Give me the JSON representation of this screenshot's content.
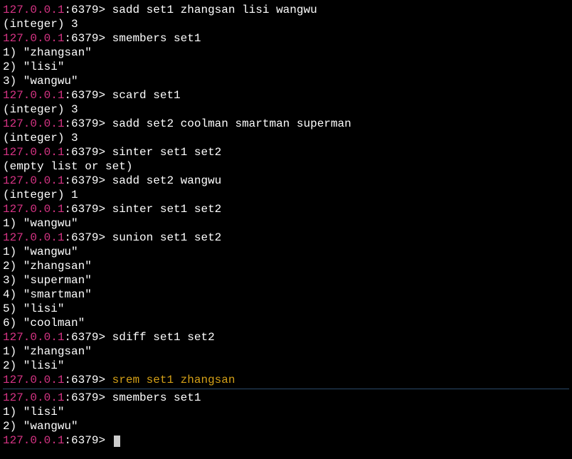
{
  "prompt": {
    "host": "127.0.0.1",
    "port": ":6379",
    "arrow": "> "
  },
  "lines": [
    {
      "type": "cmd",
      "host": "127.0.0.1",
      "port": ":6379",
      "arrow": "> ",
      "text": "sadd set1 zhangsan lisi wangwu"
    },
    {
      "type": "out",
      "text": "(integer) 3"
    },
    {
      "type": "cmd",
      "host": "127.0.0.1",
      "port": ":6379",
      "arrow": "> ",
      "text": "smembers set1"
    },
    {
      "type": "out",
      "text": "1) \"zhangsan\""
    },
    {
      "type": "out",
      "text": "2) \"lisi\""
    },
    {
      "type": "out",
      "text": "3) \"wangwu\""
    },
    {
      "type": "cmd",
      "host": "127.0.0.1",
      "port": ":6379",
      "arrow": "> ",
      "text": "scard set1"
    },
    {
      "type": "out",
      "text": "(integer) 3"
    },
    {
      "type": "cmd",
      "host": "127.0.0.1",
      "port": ":6379",
      "arrow": "> ",
      "text": "sadd set2 coolman smartman superman"
    },
    {
      "type": "out",
      "text": "(integer) 3"
    },
    {
      "type": "cmd",
      "host": "127.0.0.1",
      "port": ":6379",
      "arrow": "> ",
      "text": "sinter set1 set2"
    },
    {
      "type": "out",
      "text": "(empty list or set)"
    },
    {
      "type": "cmd",
      "host": "127.0.0.1",
      "port": ":6379",
      "arrow": "> ",
      "text": "sadd set2 wangwu"
    },
    {
      "type": "out",
      "text": "(integer) 1"
    },
    {
      "type": "cmd",
      "host": "127.0.0.1",
      "port": ":6379",
      "arrow": "> ",
      "text": "sinter set1 set2"
    },
    {
      "type": "out",
      "text": "1) \"wangwu\""
    },
    {
      "type": "cmd",
      "host": "127.0.0.1",
      "port": ":6379",
      "arrow": "> ",
      "text": "sunion set1 set2"
    },
    {
      "type": "out",
      "text": "1) \"wangwu\""
    },
    {
      "type": "out",
      "text": "2) \"zhangsan\""
    },
    {
      "type": "out",
      "text": "3) \"superman\""
    },
    {
      "type": "out",
      "text": "4) \"smartman\""
    },
    {
      "type": "out",
      "text": "5) \"lisi\""
    },
    {
      "type": "out",
      "text": "6) \"coolman\""
    },
    {
      "type": "cmd",
      "host": "127.0.0.1",
      "port": ":6379",
      "arrow": "> ",
      "text": "sdiff set1 set2"
    },
    {
      "type": "out",
      "text": "1) \"zhangsan\""
    },
    {
      "type": "out",
      "text": "2) \"lisi\""
    },
    {
      "type": "cmd-yellow",
      "host": "127.0.0.1",
      "port": ":6379",
      "arrow": "> ",
      "text": "srem set1 zhangsan"
    },
    {
      "type": "sep"
    },
    {
      "type": "cmd",
      "host": "127.0.0.1",
      "port": ":6379",
      "arrow": "> ",
      "text": "smembers set1"
    },
    {
      "type": "out",
      "text": "1) \"lisi\""
    },
    {
      "type": "out",
      "text": "2) \"wangwu\""
    },
    {
      "type": "prompt-cursor",
      "host": "127.0.0.1",
      "port": ":6379",
      "arrow": "> "
    }
  ]
}
